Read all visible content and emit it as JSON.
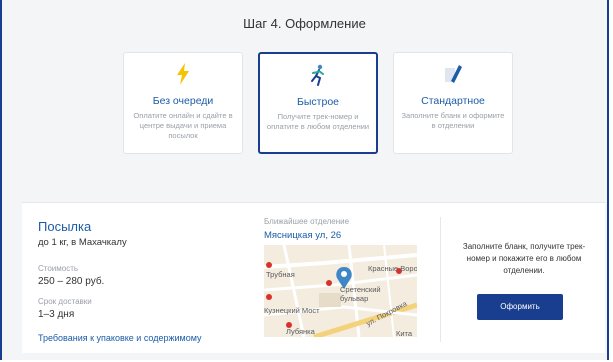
{
  "step": {
    "title": "Шаг 4. Оформление"
  },
  "options": [
    {
      "title": "Без очереди",
      "desc": "Оплатите онлайн и сдайте в центре выдачи и приема посылок",
      "icon": "lightning-icon",
      "selected": false
    },
    {
      "title": "Быстрое",
      "desc": "Получите трек-номер и оплатите в любом отделении",
      "icon": "runner-icon",
      "selected": true
    },
    {
      "title": "Стандартное",
      "desc": "Заполните бланк и оформите в отделении",
      "icon": "form-pen-icon",
      "selected": false
    }
  ],
  "parcel": {
    "title": "Посылка",
    "subtitle": "до 1 кг, в Махачкалу",
    "cost_label": "Стоимость",
    "cost_value": "250 – 280 руб.",
    "term_label": "Срок доставки",
    "term_value": "1–3 дня",
    "requirements_link": "Требования к упаковке и содержимому"
  },
  "office": {
    "label": "Ближайшее отделение",
    "address": "Мясницкая ул, 26",
    "map_labels": {
      "l1": "Трубная",
      "l2": "Красные Ворот",
      "l3": "Сретенский",
      "l4": "бульвар",
      "l5": "Кузнецкий Мост",
      "l6": "Лубянка",
      "l7": "ул. Покровка",
      "l8": "Кита"
    }
  },
  "action": {
    "hint": "Заполните бланк, получите трек-номер и покажите его в любом отделении.",
    "button": "Оформить"
  },
  "colors": {
    "accent": "#1a3e8f",
    "link": "#1b5ca8",
    "lightning": "#f5c400"
  }
}
